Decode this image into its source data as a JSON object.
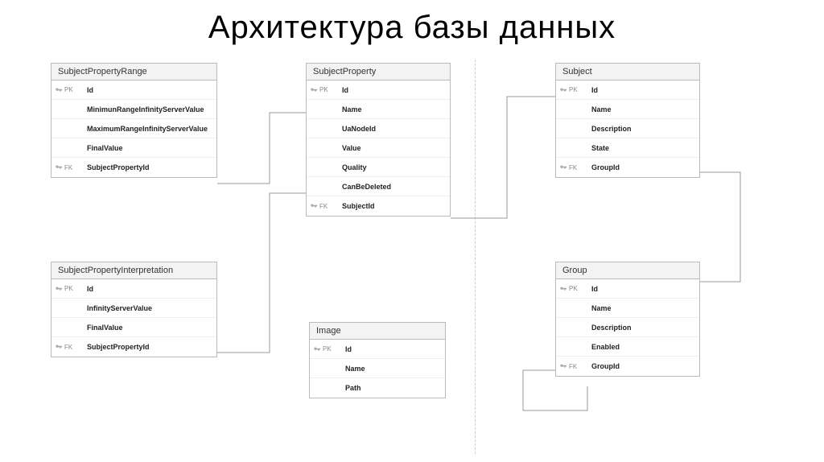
{
  "title": "Архитектура базы данных",
  "tables": {
    "spr": {
      "name": "SubjectPropertyRange",
      "fields": [
        {
          "key": "PK",
          "name": "Id"
        },
        {
          "key": "",
          "name": "MinimunRangeInfinityServerValue"
        },
        {
          "key": "",
          "name": "MaximumRangeInfinityServerValue"
        },
        {
          "key": "",
          "name": "FinalValue"
        },
        {
          "key": "FK",
          "name": "SubjectPropertyId"
        }
      ]
    },
    "sp": {
      "name": "SubjectProperty",
      "fields": [
        {
          "key": "PK",
          "name": "Id"
        },
        {
          "key": "",
          "name": "Name"
        },
        {
          "key": "",
          "name": "UaNodeId"
        },
        {
          "key": "",
          "name": "Value"
        },
        {
          "key": "",
          "name": "Quality"
        },
        {
          "key": "",
          "name": "CanBeDeleted"
        },
        {
          "key": "FK",
          "name": "SubjectId"
        }
      ]
    },
    "subject": {
      "name": "Subject",
      "fields": [
        {
          "key": "PK",
          "name": "Id"
        },
        {
          "key": "",
          "name": "Name"
        },
        {
          "key": "",
          "name": "Description"
        },
        {
          "key": "",
          "name": "State"
        },
        {
          "key": "FK",
          "name": "GroupId"
        }
      ]
    },
    "spi": {
      "name": "SubjectPropertyInterpretation",
      "fields": [
        {
          "key": "PK",
          "name": "Id"
        },
        {
          "key": "",
          "name": "InfinityServerValue"
        },
        {
          "key": "",
          "name": "FinalValue"
        },
        {
          "key": "FK",
          "name": "SubjectPropertyId"
        }
      ]
    },
    "image": {
      "name": "Image",
      "fields": [
        {
          "key": "PK",
          "name": "Id"
        },
        {
          "key": "",
          "name": "Name"
        },
        {
          "key": "",
          "name": "Path"
        }
      ]
    },
    "group": {
      "name": "Group",
      "fields": [
        {
          "key": "PK",
          "name": "Id"
        },
        {
          "key": "",
          "name": "Name"
        },
        {
          "key": "",
          "name": "Description"
        },
        {
          "key": "",
          "name": "Enabled"
        },
        {
          "key": "FK",
          "name": "GroupId"
        }
      ]
    }
  }
}
